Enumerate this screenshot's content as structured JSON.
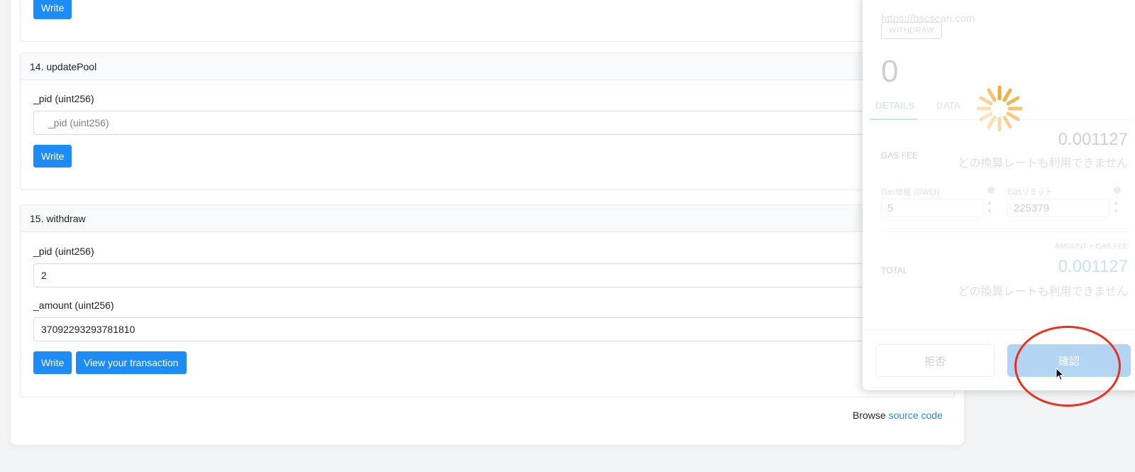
{
  "functions": {
    "prev": {
      "write_label": "Write"
    },
    "f14": {
      "title": "14. updatePool",
      "param_label": "_pid (uint256)",
      "param_placeholder": "_pid (uint256)",
      "write_label": "Write"
    },
    "f15": {
      "title": "15. withdraw",
      "pid_label": "_pid (uint256)",
      "pid_value": "2",
      "amount_label": "_amount (uint256)",
      "amount_value": "37092293293781810",
      "write_label": "Write",
      "view_tx_label": "View your transaction"
    }
  },
  "footer": {
    "browse_text": "Browse",
    "source_link": "source code"
  },
  "wallet": {
    "origin": "https://bscscan.com",
    "method": "WITHDRAW",
    "amount": "0",
    "tabs": [
      "DETAILS",
      "DATA"
    ],
    "active_tab": "DETAILS",
    "gas_fee_label": "GAS FEE",
    "gas_fee_value": "0.001127",
    "rate_unavailable": "どの換算レートも利用できません",
    "gas_price_label": "Gas価格 (GWEI)",
    "gas_price_value": "5",
    "gas_limit_label": "Gasリミット",
    "gas_limit_value": "225379",
    "amount_gas_label": "AMOUNT + GAS FEE",
    "total_label": "TOTAL",
    "total_value": "0.001127",
    "reject_label": "拒否",
    "confirm_label": "確認"
  },
  "colors": {
    "primary_button": "#1e8cf7",
    "wallet_accent": "#037dd6",
    "highlight_circle": "#e6321f",
    "spinner": "#f0a830"
  },
  "icons": [
    "loading-spinner-icon",
    "info-icon",
    "cursor-pointer-icon"
  ]
}
